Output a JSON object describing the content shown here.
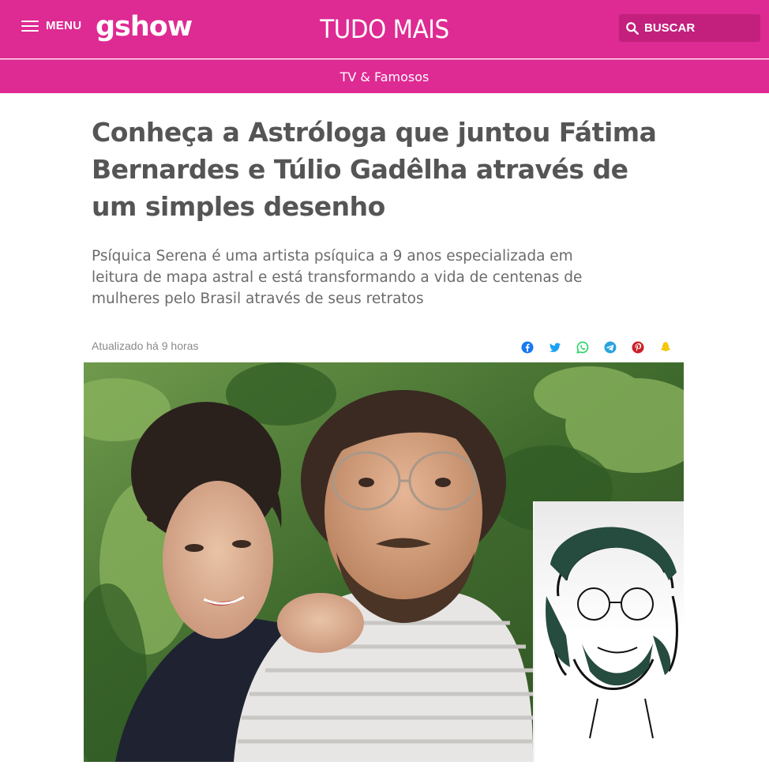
{
  "header": {
    "menu_label": "MENU",
    "logo_text": "gshow",
    "section_title": "TUDO MAIS",
    "search_label": "BUSCAR",
    "brand_color": "#de2a93"
  },
  "subnav": {
    "category_link": "TV & Famosos"
  },
  "article": {
    "headline": "Conheça a Astróloga que juntou Fátima Bernardes e Túlio Gadêlha através de um simples desenho",
    "subtitle": "Psíquica Serena é uma artista psíquica a 9 anos especializada em leitura de mapa astral e está transformando a vida de centenas de mulheres pelo Brasil através de seus retratos",
    "updated": "Atualizado há 9 horas"
  },
  "share_icons": [
    {
      "icon": "facebook-icon",
      "color": "#3b5998"
    },
    {
      "icon": "twitter-icon",
      "color": "#1da1f2"
    },
    {
      "icon": "whatsapp-icon",
      "color": "#25d366"
    },
    {
      "icon": "telegram-icon",
      "color": "#2aa3de"
    },
    {
      "icon": "pinterest-icon",
      "color": "#cb2027"
    },
    {
      "icon": "snapchat-icon",
      "color": "#f7c900"
    }
  ]
}
